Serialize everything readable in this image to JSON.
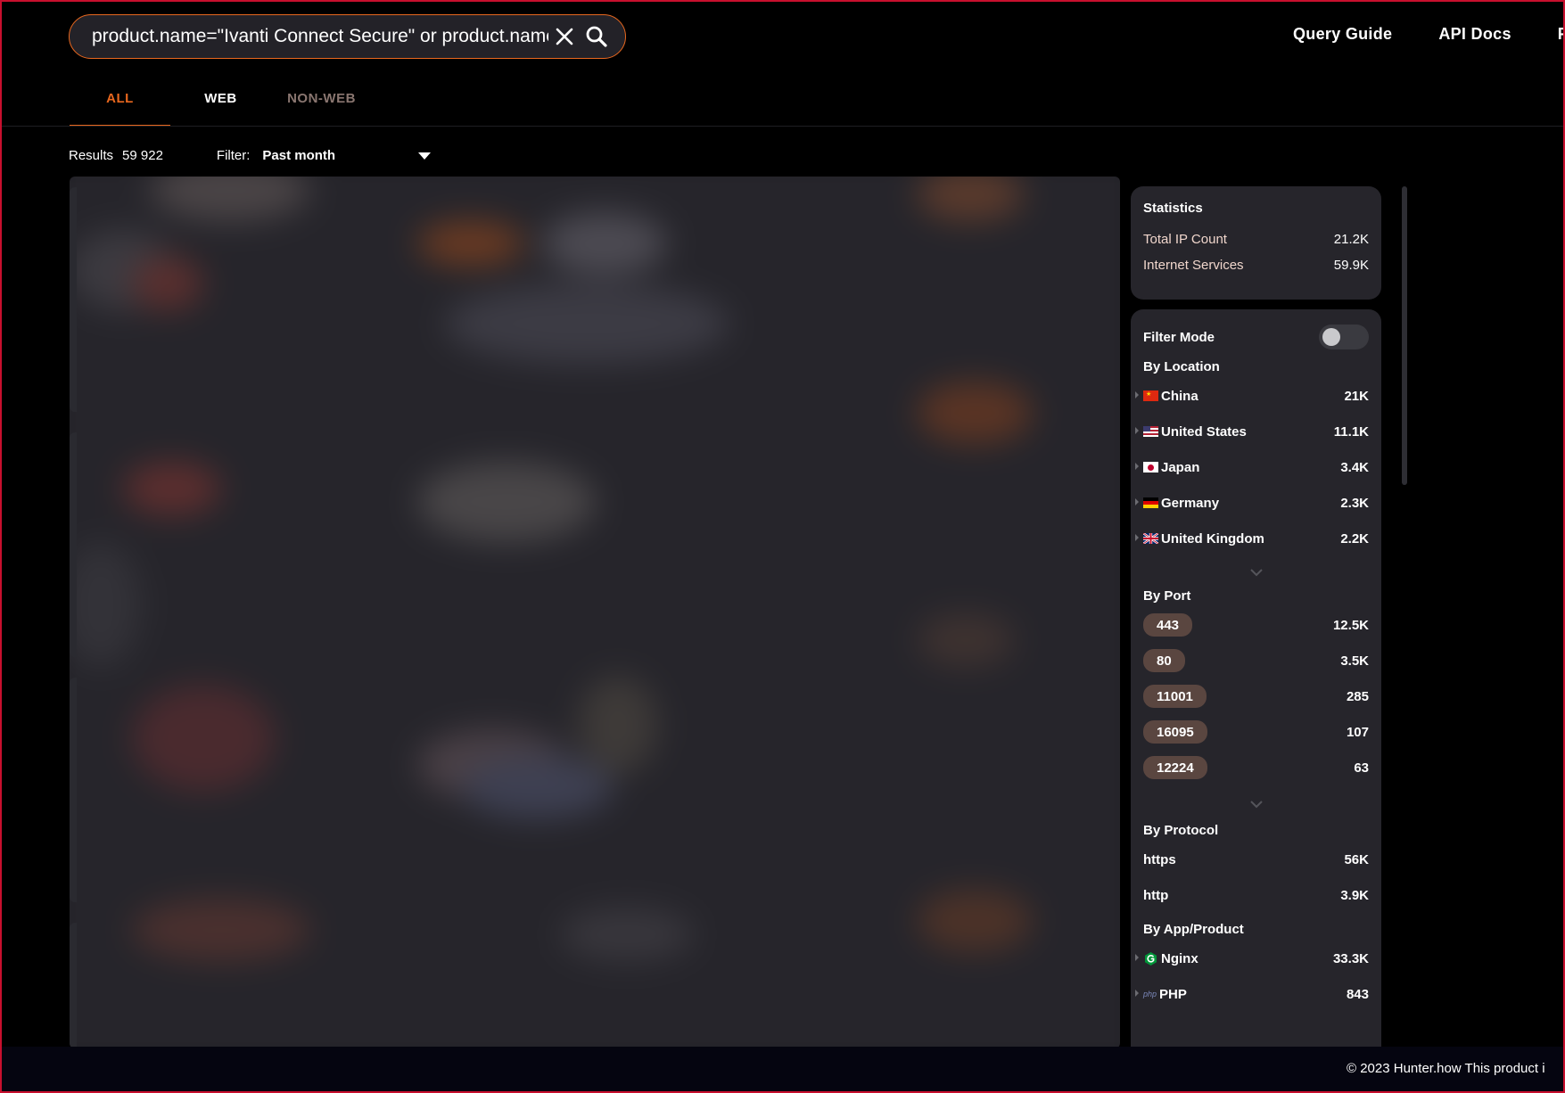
{
  "header": {
    "search_value": "product.name=\"Ivanti Connect Secure\" or product.name=\"I",
    "nav": [
      "Query Guide",
      "API Docs",
      "F"
    ]
  },
  "tabs": [
    {
      "label": "ALL",
      "active": true
    },
    {
      "label": "WEB",
      "active": false
    },
    {
      "label": "NON-WEB",
      "active": false
    }
  ],
  "results": {
    "label": "Results",
    "count": "59 922",
    "filter_label": "Filter:",
    "filter_value": "Past month"
  },
  "statistics": {
    "title": "Statistics",
    "rows": [
      {
        "label": "Total IP Count",
        "value": "21.2K"
      },
      {
        "label": "Internet Services",
        "value": "59.9K"
      }
    ]
  },
  "facets": {
    "filter_mode_label": "Filter Mode",
    "filter_mode_on": false,
    "location": {
      "title": "By Location",
      "items": [
        {
          "name": "China",
          "value": "21K",
          "flag": "cn-flag-icon"
        },
        {
          "name": "United States",
          "value": "11.1K",
          "flag": "us-flag-icon"
        },
        {
          "name": "Japan",
          "value": "3.4K",
          "flag": "jp-flag-icon"
        },
        {
          "name": "Germany",
          "value": "2.3K",
          "flag": "de-flag-icon"
        },
        {
          "name": "United Kingdom",
          "value": "2.2K",
          "flag": "gb-flag-icon"
        }
      ]
    },
    "port": {
      "title": "By Port",
      "items": [
        {
          "name": "443",
          "value": "12.5K"
        },
        {
          "name": "80",
          "value": "3.5K"
        },
        {
          "name": "11001",
          "value": "285"
        },
        {
          "name": "16095",
          "value": "107"
        },
        {
          "name": "12224",
          "value": "63"
        }
      ]
    },
    "protocol": {
      "title": "By Protocol",
      "items": [
        {
          "name": "https",
          "value": "56K"
        },
        {
          "name": "http",
          "value": "3.9K"
        }
      ]
    },
    "product": {
      "title": "By App/Product",
      "items": [
        {
          "name": "Nginx",
          "value": "33.3K",
          "icon": "nginx-icon"
        },
        {
          "name": "PHP",
          "value": "843",
          "icon": "php-icon"
        }
      ]
    }
  },
  "footer": {
    "text": "© 2023 Hunter.how  This product i"
  },
  "colors": {
    "accent": "#e8671e",
    "panel": "#26252b",
    "chip": "#5a4640"
  }
}
